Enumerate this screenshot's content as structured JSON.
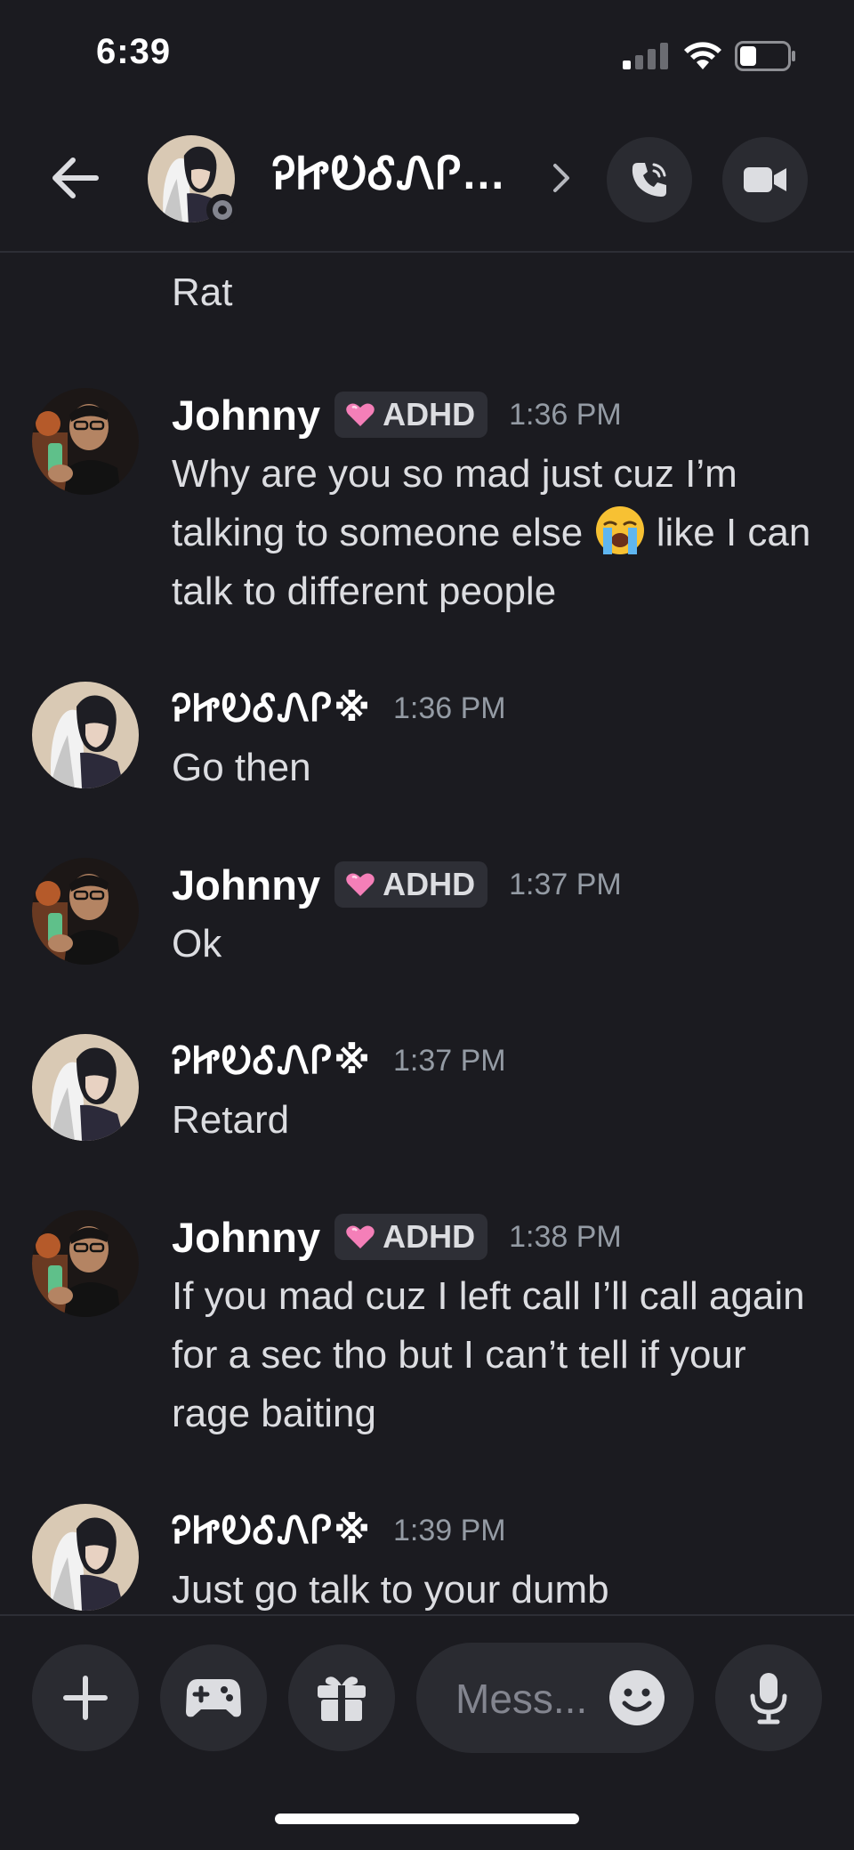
{
  "status_bar": {
    "time": "6:39"
  },
  "header": {
    "channel_name": "ᎮᏥᎧᎴᏁᎵ..."
  },
  "continuation": {
    "text": "Rat"
  },
  "messages": [
    {
      "author": "Johnny",
      "badge": "ADHD",
      "time": "1:36 PM",
      "text_before_emoji": "Why are you so mad just cuz I’m talking to someone else ",
      "emoji": "loudly-crying-face",
      "text_after_emoji": " like I can talk to different people"
    },
    {
      "author": "ᎮᏥᎧᎴᏁᎵ※",
      "time": "1:36 PM",
      "text": "Go then"
    },
    {
      "author": "Johnny",
      "badge": "ADHD",
      "time": "1:37 PM",
      "text": "Ok"
    },
    {
      "author": "ᎮᏥᎧᎴᏁᎵ※",
      "time": "1:37 PM",
      "text": "Retard"
    },
    {
      "author": "Johnny",
      "badge": "ADHD",
      "time": "1:38 PM",
      "text": "If you mad cuz I left call I’ll call again for a sec tho but I can’t tell if your rage baiting"
    },
    {
      "author": "ᎮᏥᎧᎴᏁᎵ※",
      "time": "1:39 PM",
      "text": "Just go talk to your dumb"
    }
  ],
  "composer": {
    "placeholder": "Mess..."
  },
  "colors": {
    "background": "#1b1b20",
    "button": "#2a2b31",
    "muted_text": "#949ba4",
    "body_text": "#dcdde1",
    "badge_heart": "#f47fb8"
  }
}
